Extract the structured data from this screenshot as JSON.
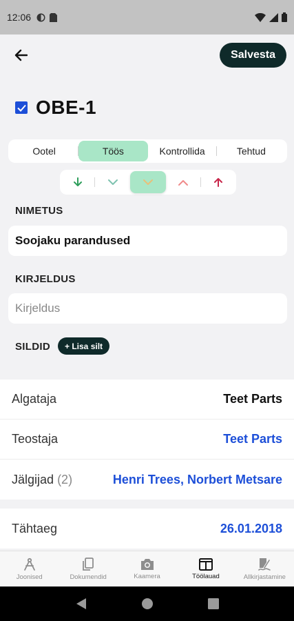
{
  "status_bar": {
    "time": "12:06"
  },
  "topbar": {
    "save_label": "Salvesta"
  },
  "title": "OBE-1",
  "status_tabs": [
    {
      "label": "Ootel",
      "active": false
    },
    {
      "label": "Töös",
      "active": true
    },
    {
      "label": "Kontrollida",
      "active": false
    },
    {
      "label": "Tehtud",
      "active": false
    }
  ],
  "priority": {
    "levels": [
      "lowest",
      "low",
      "medium",
      "high",
      "highest"
    ],
    "selected": "medium",
    "colors": {
      "lowest": "#2e9e5b",
      "low": "#7fc3b0",
      "medium": "#e8c07a",
      "high": "#f08a8a",
      "highest": "#c8264a"
    }
  },
  "name_section": {
    "label": "NIMETUS",
    "value": "Soojaku parandused"
  },
  "description_section": {
    "label": "KIRJELDUS",
    "placeholder": "Kirjeldus"
  },
  "tags_section": {
    "label": "SILDID",
    "add_label": "+ Lisa silt"
  },
  "details": [
    {
      "label": "Algataja",
      "value": "Teet Parts",
      "link": false
    },
    {
      "label": "Teostaja",
      "value": "Teet Parts",
      "link": true
    },
    {
      "label": "Jälgijad",
      "count": "(2)",
      "value": "Henri Trees, Norbert Metsare",
      "link": true
    }
  ],
  "deadline": {
    "label": "Tähtaeg",
    "value": "26.01.2018"
  },
  "bottom_nav": [
    {
      "label": "Joonised",
      "icon": "compass-icon",
      "active": false
    },
    {
      "label": "Dokumendid",
      "icon": "documents-icon",
      "active": false
    },
    {
      "label": "Kaamera",
      "icon": "camera-icon",
      "active": false
    },
    {
      "label": "Töölauad",
      "icon": "board-icon",
      "active": true
    },
    {
      "label": "Allkirjastamine",
      "icon": "signature-icon",
      "active": false
    }
  ]
}
